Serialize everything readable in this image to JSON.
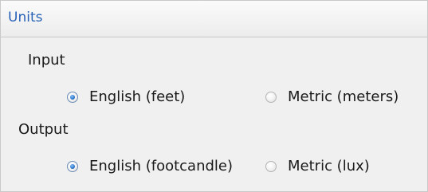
{
  "panel": {
    "title": "Units"
  },
  "input": {
    "label": "Input",
    "options": [
      {
        "label": "English (feet)",
        "selected": true
      },
      {
        "label": "Metric (meters)",
        "selected": false
      }
    ]
  },
  "output": {
    "label": "Output",
    "options": [
      {
        "label": "English (footcandle)",
        "selected": true
      },
      {
        "label": "Metric (lux)",
        "selected": false
      }
    ]
  },
  "colors": {
    "title": "#2a63b8",
    "panel_background": "#f0f0f0",
    "radio_dot": "#2d7ad0"
  }
}
